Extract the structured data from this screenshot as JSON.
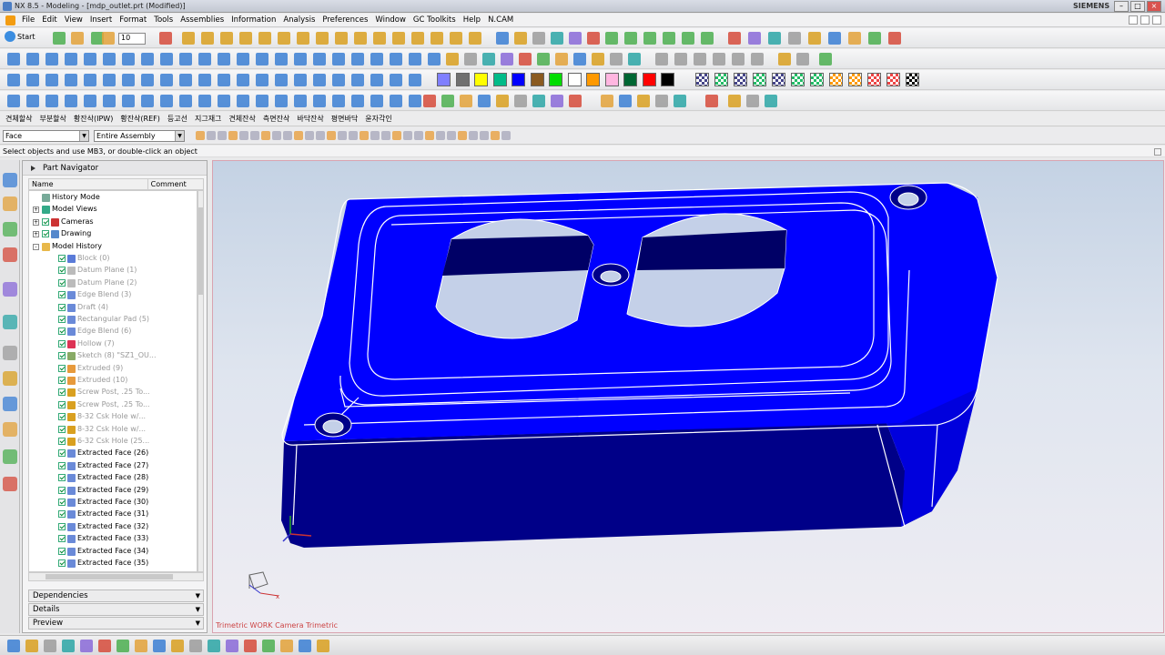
{
  "window": {
    "title": "NX 8.5 - Modeling - [mdp_outlet.prt (Modified)]",
    "brand": "SIEMENS"
  },
  "menu": [
    "File",
    "Edit",
    "View",
    "Insert",
    "Format",
    "Tools",
    "Assemblies",
    "Information",
    "Analysis",
    "Preferences",
    "Window",
    "GC Toolkits",
    "Help",
    "N.CAM"
  ],
  "toolbar": {
    "start_label": "Start",
    "zoom_value": "10"
  },
  "korean_bar": [
    "견체할삭",
    "부분할삭",
    "황잔삭(IPW)",
    "황잔삭(REF)",
    "등고선",
    "지그재그",
    "견체잔삭",
    "측면잔삭",
    "바닥잔삭",
    "평면바닥",
    "윤자각인"
  ],
  "selection": {
    "filter": "Face",
    "scope": "Entire Assembly"
  },
  "cue_line": "Select objects and use MB3, or double-click an object",
  "navigator": {
    "title": "Part Navigator",
    "col_name": "Name",
    "col_comment": "Comment",
    "nodes": [
      {
        "label": "History Mode",
        "indent": 0,
        "exp": "",
        "check": false,
        "grey": false,
        "icon": "history-icon",
        "color": "#7a9"
      },
      {
        "label": "Model Views",
        "indent": 0,
        "exp": "+",
        "check": false,
        "grey": false,
        "icon": "views-icon",
        "color": "#3a8"
      },
      {
        "label": "Cameras",
        "indent": 0,
        "exp": "+",
        "check": true,
        "grey": false,
        "icon": "camera-icon",
        "color": "#c33"
      },
      {
        "label": "Drawing",
        "indent": 0,
        "exp": "+",
        "check": true,
        "grey": false,
        "icon": "drawing-icon",
        "color": "#58c"
      },
      {
        "label": "Model History",
        "indent": 0,
        "exp": "-",
        "check": false,
        "grey": false,
        "icon": "folder-icon",
        "color": "#e8b84a"
      },
      {
        "label": "Block (0)",
        "indent": 1,
        "exp": "",
        "check": true,
        "grey": true,
        "icon": "block-icon",
        "color": "#5a7bd8"
      },
      {
        "label": "Datum Plane (1)",
        "indent": 1,
        "exp": "",
        "check": true,
        "grey": true,
        "icon": "datum-plane-icon",
        "color": "#bbb"
      },
      {
        "label": "Datum Plane (2)",
        "indent": 1,
        "exp": "",
        "check": true,
        "grey": true,
        "icon": "datum-plane-icon",
        "color": "#bbb"
      },
      {
        "label": "Edge Blend (3)",
        "indent": 1,
        "exp": "",
        "check": true,
        "grey": true,
        "icon": "edge-blend-icon",
        "color": "#6a8ad8"
      },
      {
        "label": "Draft (4)",
        "indent": 1,
        "exp": "",
        "check": true,
        "grey": true,
        "icon": "draft-icon",
        "color": "#6a8ad8"
      },
      {
        "label": "Rectangular Pad (5)",
        "indent": 1,
        "exp": "",
        "check": true,
        "grey": true,
        "icon": "pad-icon",
        "color": "#6a8ad8"
      },
      {
        "label": "Edge Blend (6)",
        "indent": 1,
        "exp": "",
        "check": true,
        "grey": true,
        "icon": "edge-blend-icon",
        "color": "#6a8ad8"
      },
      {
        "label": "Hollow (7)",
        "indent": 1,
        "exp": "",
        "check": true,
        "grey": true,
        "icon": "hollow-icon",
        "color": "#d35"
      },
      {
        "label": "Sketch (8) \"SZ1_OU...",
        "indent": 1,
        "exp": "",
        "check": true,
        "grey": true,
        "icon": "sketch-icon",
        "color": "#8a6"
      },
      {
        "label": "Extruded (9)",
        "indent": 1,
        "exp": "",
        "check": true,
        "grey": true,
        "icon": "extrude-icon",
        "color": "#e79a3c"
      },
      {
        "label": "Extruded (10)",
        "indent": 1,
        "exp": "",
        "check": true,
        "grey": true,
        "icon": "extrude-icon",
        "color": "#e79a3c"
      },
      {
        "label": "Screw Post, .25 To...",
        "indent": 1,
        "exp": "",
        "check": true,
        "grey": true,
        "icon": "udf-icon",
        "color": "#d9a020"
      },
      {
        "label": "Screw Post, .25 To...",
        "indent": 1,
        "exp": "",
        "check": true,
        "grey": true,
        "icon": "udf-icon",
        "color": "#d9a020"
      },
      {
        "label": "8-32 Csk Hole w/...",
        "indent": 1,
        "exp": "",
        "check": true,
        "grey": true,
        "icon": "udf-icon",
        "color": "#d9a020"
      },
      {
        "label": "8-32 Csk Hole w/...",
        "indent": 1,
        "exp": "",
        "check": true,
        "grey": true,
        "icon": "udf-icon",
        "color": "#d9a020"
      },
      {
        "label": "6-32 Csk Hole (25...",
        "indent": 1,
        "exp": "",
        "check": true,
        "grey": true,
        "icon": "udf-icon",
        "color": "#d9a020"
      },
      {
        "label": "Extracted Face (26)",
        "indent": 1,
        "exp": "",
        "check": true,
        "grey": false,
        "icon": "extract-icon",
        "color": "#6a8ad8"
      },
      {
        "label": "Extracted Face (27)",
        "indent": 1,
        "exp": "",
        "check": true,
        "grey": false,
        "icon": "extract-icon",
        "color": "#6a8ad8"
      },
      {
        "label": "Extracted Face (28)",
        "indent": 1,
        "exp": "",
        "check": true,
        "grey": false,
        "icon": "extract-icon",
        "color": "#6a8ad8"
      },
      {
        "label": "Extracted Face (29)",
        "indent": 1,
        "exp": "",
        "check": true,
        "grey": false,
        "icon": "extract-icon",
        "color": "#6a8ad8"
      },
      {
        "label": "Extracted Face (30)",
        "indent": 1,
        "exp": "",
        "check": true,
        "grey": false,
        "icon": "extract-icon",
        "color": "#6a8ad8"
      },
      {
        "label": "Extracted Face (31)",
        "indent": 1,
        "exp": "",
        "check": true,
        "grey": false,
        "icon": "extract-icon",
        "color": "#6a8ad8"
      },
      {
        "label": "Extracted Face (32)",
        "indent": 1,
        "exp": "",
        "check": true,
        "grey": false,
        "icon": "extract-icon",
        "color": "#6a8ad8"
      },
      {
        "label": "Extracted Face (33)",
        "indent": 1,
        "exp": "",
        "check": true,
        "grey": false,
        "icon": "extract-icon",
        "color": "#6a8ad8"
      },
      {
        "label": "Extracted Face (34)",
        "indent": 1,
        "exp": "",
        "check": true,
        "grey": false,
        "icon": "extract-icon",
        "color": "#6a8ad8"
      },
      {
        "label": "Extracted Face (35)",
        "indent": 1,
        "exp": "",
        "check": true,
        "grey": false,
        "icon": "extract-icon",
        "color": "#6a8ad8"
      }
    ],
    "panels": [
      "Dependencies",
      "Details",
      "Preview"
    ]
  },
  "viewport": {
    "label": "Trimetric WORK Camera Trimetric",
    "model_color": "#0000ff",
    "edge_color": "#ffffff"
  },
  "colors": {
    "swatches": [
      "#7f7fff",
      "#707070",
      "#ffff00",
      "#00bb88",
      "#0000ff",
      "#8a5a20",
      "#00dd00",
      "#ffffff",
      "#ff9900",
      "#ffb6e0",
      "#006633",
      "#ff0000",
      "#000000"
    ]
  }
}
